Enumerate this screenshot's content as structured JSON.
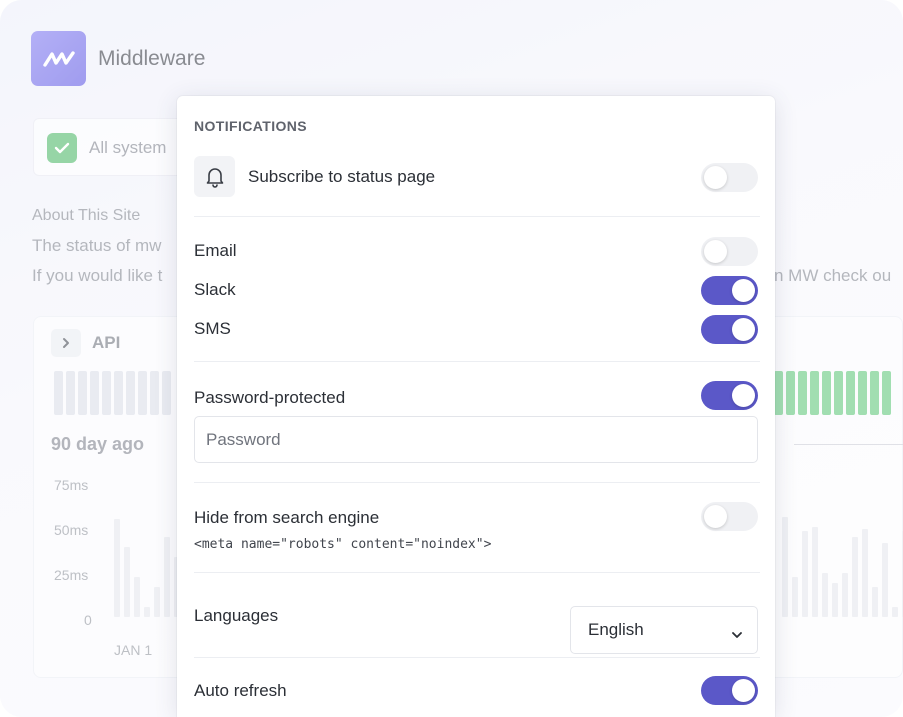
{
  "background": {
    "brand_name": "Middleware",
    "status_text": "All system",
    "about_title": "About This Site",
    "about_line1": "The status of mw",
    "about_line2": "If you would like t",
    "about_line2_right": "n MW check ou",
    "api_card": {
      "label": "API",
      "day_ago": "90 day ago",
      "y_ticks": [
        "75ms",
        "50ms",
        "25ms",
        "0"
      ],
      "x_tick": "JAN 1"
    }
  },
  "popup": {
    "section_title": "NOTIFICATIONS",
    "subscribe": {
      "label": "Subscribe to status page",
      "enabled": false
    },
    "channels": [
      {
        "label": "Email",
        "enabled": false
      },
      {
        "label": "Slack",
        "enabled": true
      },
      {
        "label": "SMS",
        "enabled": true
      }
    ],
    "password_protected": {
      "label": "Password-protected",
      "enabled": true,
      "placeholder": "Password",
      "value": ""
    },
    "hide_search": {
      "label": "Hide from search engine",
      "meta": "<meta name=\"robots\" content=\"noindex\">",
      "enabled": false
    },
    "languages": {
      "label": "Languages",
      "selected": "English"
    },
    "auto_refresh": {
      "label": "Auto refresh",
      "enabled": true
    }
  },
  "colors": {
    "accent": "#5b58c8",
    "toggle_off": "#f0f1f4",
    "uptime_green": "#6fcc87",
    "check_green": "#5fbf77"
  },
  "icons": {
    "logo": "mw-logo-icon",
    "check": "check-icon",
    "chevron_right": "chevron-right-icon",
    "bell": "bell-icon",
    "chevron_down": "chevron-down-icon"
  }
}
